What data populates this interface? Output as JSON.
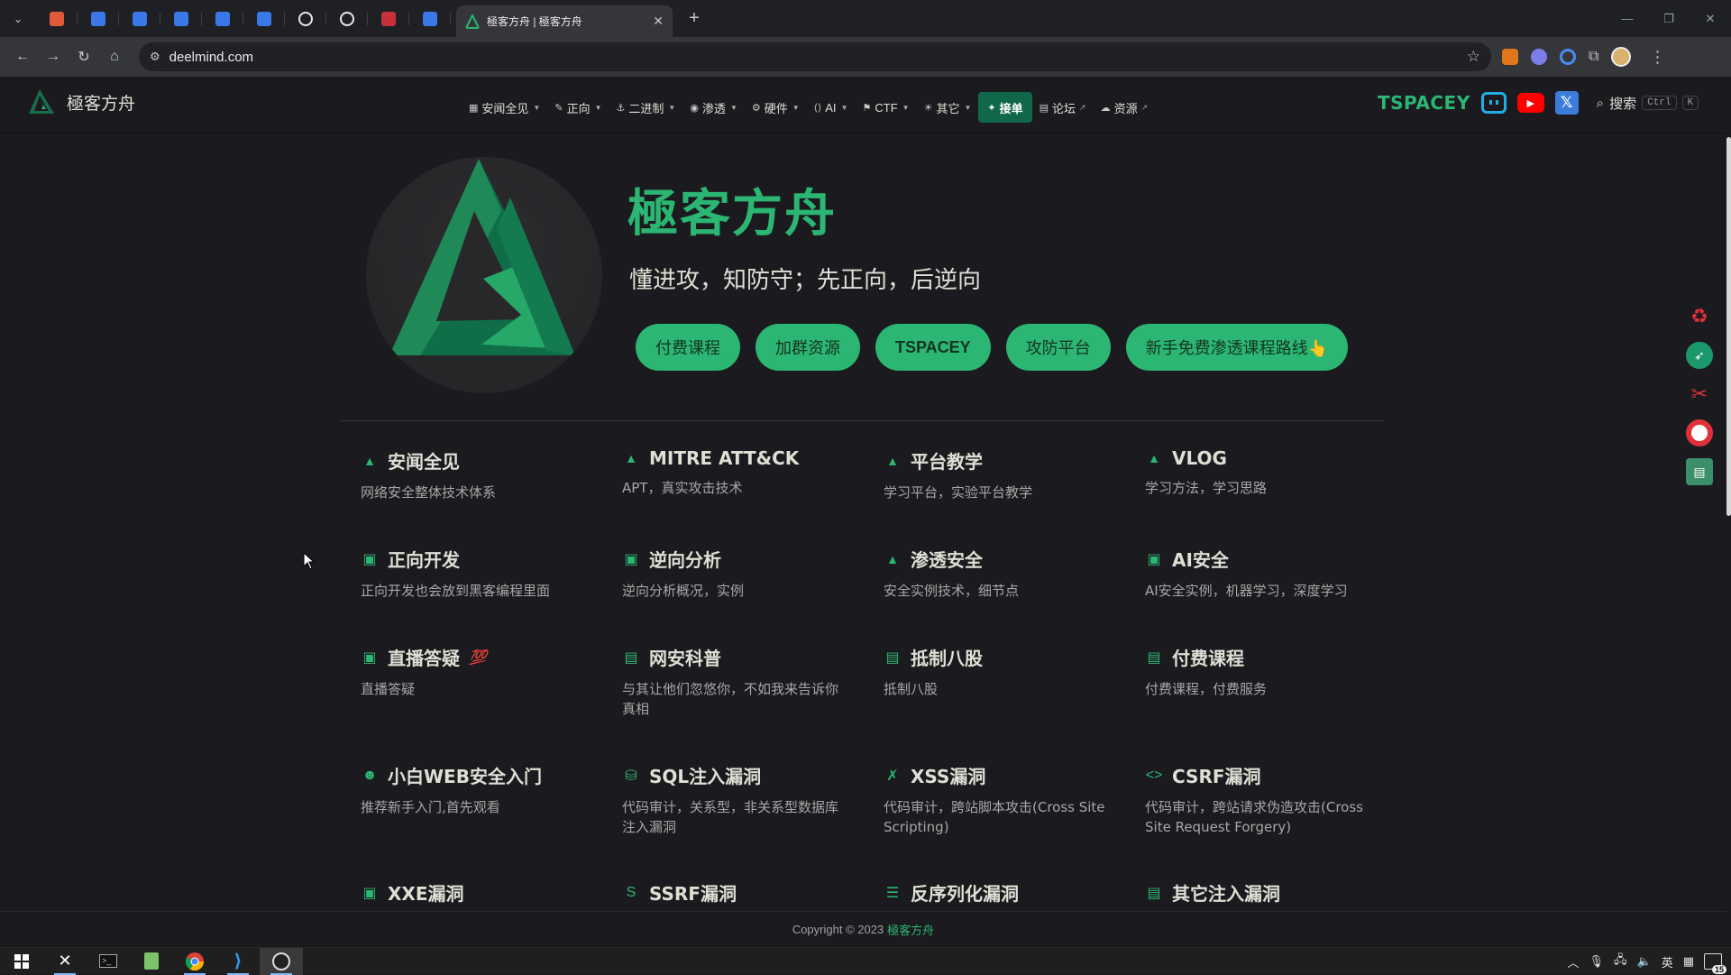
{
  "browser": {
    "pinned_tabs": [
      {
        "icon": "app-icon",
        "color": "#e05a3a"
      },
      {
        "icon": "mail-icon",
        "color": "#3a78e8"
      },
      {
        "icon": "doc-icon",
        "color": "#3a78e8"
      },
      {
        "icon": "doc-icon",
        "color": "#3a78e8"
      },
      {
        "icon": "doc-icon",
        "color": "#3a78e8"
      },
      {
        "icon": "doc-icon",
        "color": "#3a78e8"
      },
      {
        "icon": "openai-icon",
        "color": "#e8e8e8"
      },
      {
        "icon": "openai-icon",
        "color": "#e8e8e8"
      },
      {
        "icon": "profile-icon",
        "color": "#c8313b"
      },
      {
        "icon": "doc-icon",
        "color": "#3a78e8"
      }
    ],
    "active_tab_title": "極客方舟 | 極客方舟",
    "url": "deelmind.com"
  },
  "site": {
    "brand_name": "極客方舟",
    "menu": [
      {
        "icon": "grid-icon",
        "label": "安闻全见",
        "dropdown": true
      },
      {
        "icon": "pen-icon",
        "label": "正向",
        "dropdown": true
      },
      {
        "icon": "binary-icon",
        "label": "二进制",
        "dropdown": true
      },
      {
        "icon": "globe-icon",
        "label": "渗透",
        "dropdown": true
      },
      {
        "icon": "chip-icon",
        "label": "硬件",
        "dropdown": true
      },
      {
        "icon": "ai-icon",
        "label": "AI",
        "dropdown": true
      },
      {
        "icon": "flag-icon",
        "label": "CTF",
        "dropdown": true
      },
      {
        "icon": "bulb-icon",
        "label": "其它",
        "dropdown": true
      }
    ],
    "menu_active": {
      "icon": "pin-icon",
      "label": "接单"
    },
    "menu_external": [
      {
        "icon": "forum-icon",
        "label": "论坛"
      },
      {
        "icon": "cloud-icon",
        "label": "资源"
      }
    ],
    "right_logo_text": "TSPACEY",
    "search_label": "搜索",
    "search_kbd": [
      "Ctrl",
      "K"
    ],
    "accent_color": "#2bb673"
  },
  "hero": {
    "title": "極客方舟",
    "tagline": "懂进攻，知防守；先正向，后逆向",
    "buttons": [
      "付费课程",
      "加群资源",
      "TSPACEY",
      "攻防平台",
      "新手免费渗透课程路线👆"
    ]
  },
  "features": [
    {
      "icon": "mortarboard-icon",
      "title": "安闻全见",
      "desc": "网络安全整体技术体系"
    },
    {
      "icon": "mortarboard-icon",
      "title": "MITRE ATT&CK",
      "desc": "APT，真实攻击技术"
    },
    {
      "icon": "mortarboard-icon",
      "title": "平台教学",
      "desc": "学习平台，实验平台教学"
    },
    {
      "icon": "mortarboard-icon",
      "title": "VLOG",
      "desc": "学习方法，学习思路"
    },
    {
      "icon": "code-window-icon",
      "title": "正向开发",
      "desc": "正向开发也会放到黑客编程里面"
    },
    {
      "icon": "code-window-icon",
      "title": "逆向分析",
      "desc": "逆向分析概况，实例"
    },
    {
      "icon": "mortarboard-icon",
      "title": "渗透安全",
      "desc": "安全实例技术，细节点"
    },
    {
      "icon": "code-window-icon",
      "title": "AI安全",
      "desc": "AI安全实例，机器学习，深度学习"
    },
    {
      "icon": "live-icon",
      "title": "直播答疑",
      "emoji": "💯",
      "desc": "直播答疑"
    },
    {
      "icon": "newspaper-icon",
      "title": "网安科普",
      "desc": "与其让他们忽悠你，不如我来告诉你真相"
    },
    {
      "icon": "newspaper-icon",
      "title": "抵制八股",
      "desc": "抵制八股"
    },
    {
      "icon": "newspaper-icon",
      "title": "付费课程",
      "desc": "付费课程，付费服务"
    },
    {
      "icon": "smile-icon",
      "title": "小白WEB安全入门",
      "desc": "推荐新手入门,首先观看"
    },
    {
      "icon": "database-icon",
      "title": "SQL注入漏洞",
      "desc": "代码审计，关系型，非关系型数据库注入漏洞"
    },
    {
      "icon": "xss-icon",
      "title": "XSS漏洞",
      "desc": "代码审计，跨站脚本攻击(Cross Site Scripting)"
    },
    {
      "icon": "code-brackets-icon",
      "title": "CSRF漏洞",
      "desc": "代码审计，跨站请求伪造攻击(Cross Site Request Forgery)"
    },
    {
      "icon": "xxe-icon",
      "title": "XXE漏洞",
      "desc": ""
    },
    {
      "icon": "dollar-s-icon",
      "title": "SSRF漏洞",
      "desc": ""
    },
    {
      "icon": "lines-icon",
      "title": "反序列化漏洞",
      "desc": ""
    },
    {
      "icon": "list-doc-icon",
      "title": "其它注入漏洞",
      "desc": ""
    }
  ],
  "footer": {
    "text": "Copyright © 2023",
    "link": "極客方舟"
  },
  "side_icons": [
    "recycle-icon",
    "rocket-icon",
    "tools-icon",
    "target-icon",
    "stack-icon"
  ],
  "taskbar": {
    "apps": [
      "windows-start-icon",
      "xmind-icon",
      "terminal-icon",
      "notepad-icon",
      "chrome-icon",
      "vscode-icon",
      "obs-icon"
    ],
    "ime": "英",
    "notification_count": "15"
  }
}
